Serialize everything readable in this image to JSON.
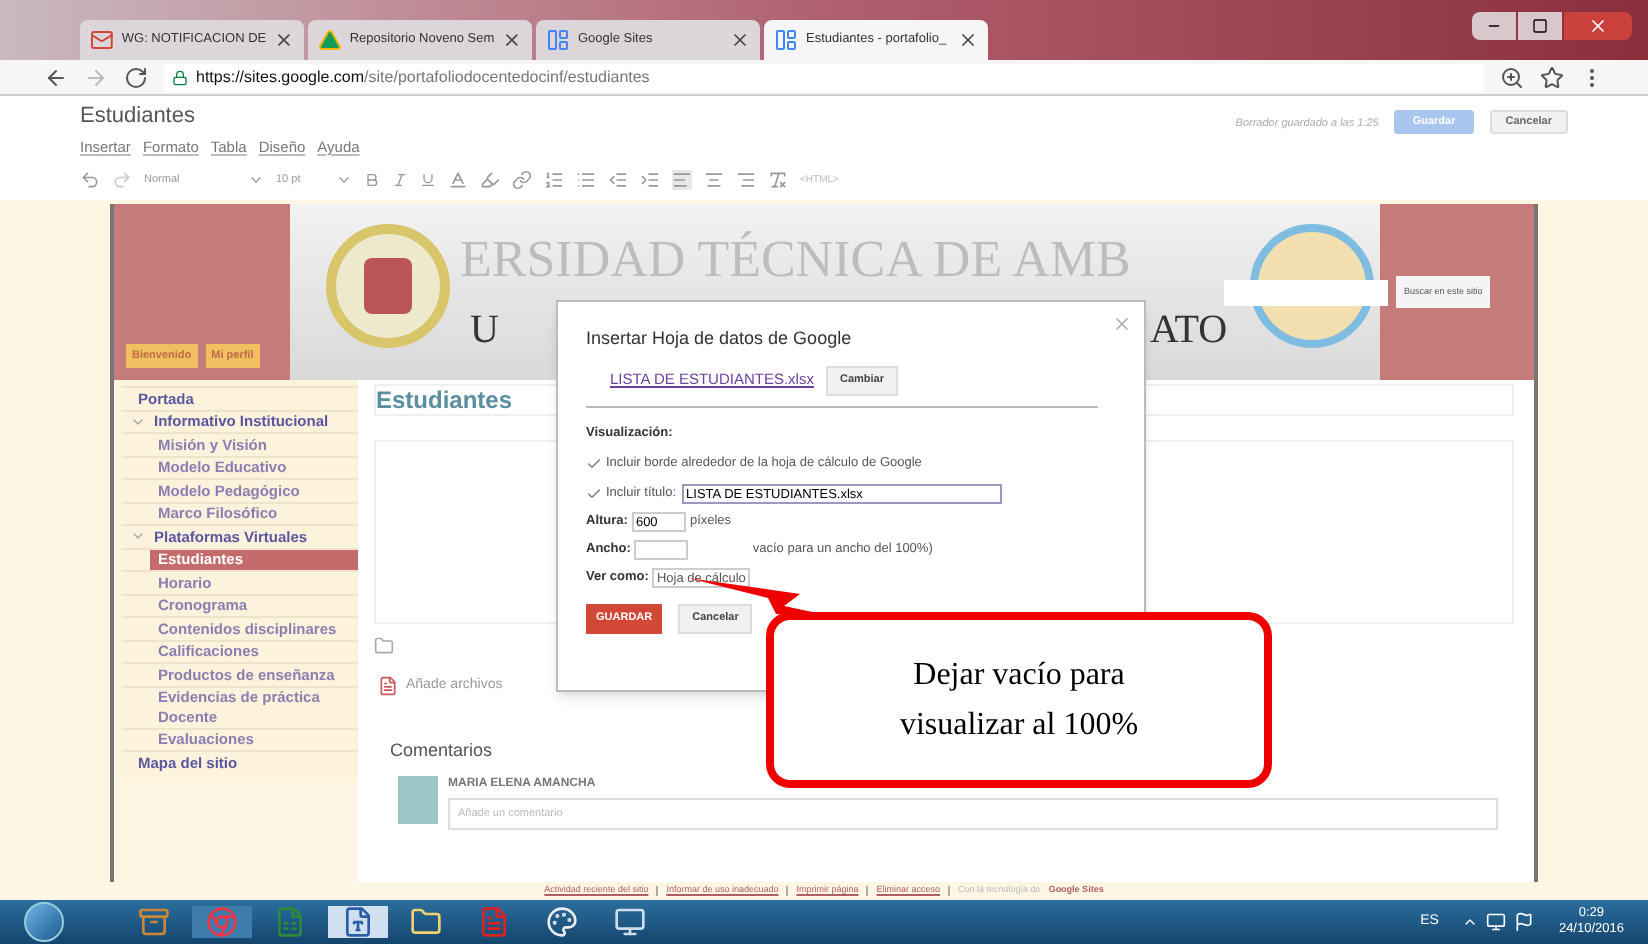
{
  "browser": {
    "tabs": [
      {
        "title": "WG: NOTIFICACION DE",
        "selected": false
      },
      {
        "title": "Repositorio Noveno Sem",
        "selected": false
      },
      {
        "title": "Google Sites",
        "selected": false
      },
      {
        "title": "Estudiantes - portafolio_",
        "selected": true
      }
    ],
    "url_host": "https://sites.google.com",
    "url_path": "/site/portafoliodocentedocinf/estudiantes"
  },
  "editor": {
    "page_title": "Estudiantes",
    "menu": [
      "Insertar",
      "Formato",
      "Tabla",
      "Diseño",
      "Ayuda"
    ],
    "draft_status": "Borrador guardado a las 1:25",
    "save_button": "Guardar",
    "cancel_button": "Cancelar",
    "toolbar": {
      "style": "Normal",
      "size": "10 pt",
      "html": "<HTML>"
    }
  },
  "banner": {
    "faded_title": "ERSIDAD TÉCNICA DE AMB",
    "title_start": "U",
    "title_end": "ATO",
    "buttons": [
      "Bienvenido",
      "Mi perfil"
    ],
    "search_button": "Buscar en este sitio"
  },
  "sidebar": {
    "items": [
      {
        "label": "Portada",
        "selected": false
      },
      {
        "label": "Informativo Institucional",
        "selected": false,
        "expanded": true,
        "children": [
          {
            "label": "Misión y Visión",
            "selected": false
          },
          {
            "label": "Modelo Educativo",
            "selected": false
          },
          {
            "label": "Modelo Pedagógico",
            "selected": false
          },
          {
            "label": "Marco Filosófico",
            "selected": false
          }
        ]
      },
      {
        "label": "Plataformas Virtuales",
        "selected": false,
        "expanded": true,
        "children": [
          {
            "label": "Estudiantes",
            "selected": true
          },
          {
            "label": "Horario",
            "selected": false
          },
          {
            "label": "Cronograma",
            "selected": false
          },
          {
            "label": "Contenidos disciplinares",
            "selected": false
          },
          {
            "label": "Calificaciones",
            "selected": false
          },
          {
            "label": "Productos de enseñanza",
            "selected": false
          },
          {
            "label": "Evidencias de práctica Docente",
            "selected": false
          },
          {
            "label": "Evaluaciones",
            "selected": false
          }
        ]
      },
      {
        "label": "Mapa del sitio",
        "selected": false
      }
    ]
  },
  "main": {
    "heading": "Estudiantes",
    "attach": "Añade archivos",
    "comments_title": "Comentarios",
    "comment_author": "MARIA ELENA AMANCHA",
    "comment_placeholder": "Añade un comentario"
  },
  "dialog": {
    "title": "Insertar Hoja de datos de Google",
    "file_link": "LISTA DE ESTUDIANTES.xlsx",
    "change_button": "Cambiar",
    "section": "Visualización:",
    "border_option": {
      "label": "Incluir borde alrededor de la hoja de cálculo de Google",
      "checked": true
    },
    "title_option": {
      "label": "Incluir título:",
      "checked": true,
      "value": "LISTA DE ESTUDIANTES.xlsx"
    },
    "height": {
      "label": "Altura:",
      "value": "600",
      "unit": "píxeles"
    },
    "width": {
      "label": "Ancho:",
      "hint": "vacío para un ancho del 100%)"
    },
    "view_as": {
      "label": "Ver como:",
      "value": "Hoja de cálculo"
    },
    "save_button": "GUARDAR",
    "cancel_button": "Cancelar"
  },
  "annotation": {
    "text": "Dejar vacío para visualizar al 100%"
  },
  "footer": {
    "links": [
      "Actividad reciente del sitio",
      "Informar de uso inadecuado",
      "Imprimir página",
      "Eliminar acceso"
    ],
    "powered": "Con la tecnología de",
    "brand": "Google Sites"
  },
  "taskbar": {
    "language": "ES",
    "time": "0:29",
    "date": "24/10/2016"
  }
}
